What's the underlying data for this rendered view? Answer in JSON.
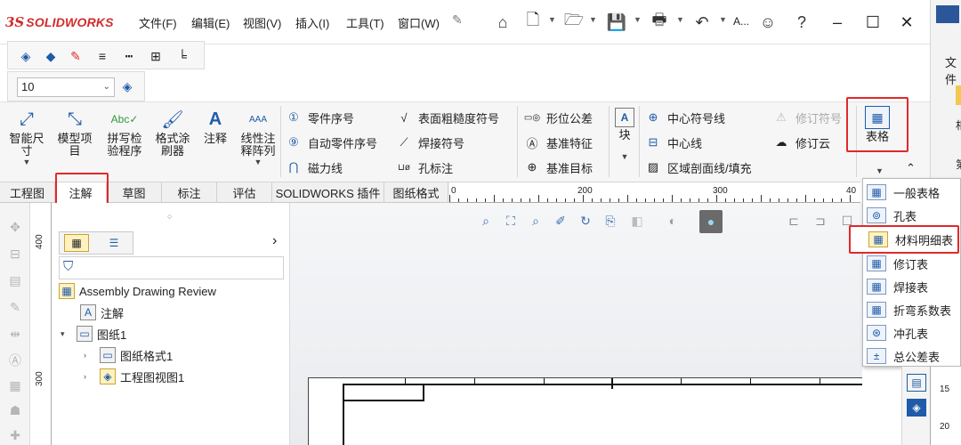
{
  "app": {
    "logo_mark": "3S",
    "logo_text": "SOLIDWORKS"
  },
  "menu": {
    "items": [
      "文件(F)",
      "编辑(E)",
      "视图(V)",
      "插入(I)",
      "工具(T)",
      "窗口(W)"
    ],
    "pin_icon": "pin-icon"
  },
  "quick_access": {
    "search_text": "A..."
  },
  "right_panel": {
    "label1": "文件",
    "label2": "相",
    "label3": "第"
  },
  "format": {
    "font_size": "10"
  },
  "ribbon": {
    "smart_dimension": "智能尺\n寸",
    "model_items": "模型项\n目",
    "spell_check": "拼写检\n验程序",
    "format_painter": "格式涂\n刷器",
    "note": "注释",
    "linear_pattern": "线性注\n释阵列",
    "balloon": "零件序号",
    "auto_balloon": "自动零件序号",
    "magnetic_line": "磁力线",
    "surface_finish": "表面粗糙度符号",
    "weld_symbol": "焊接符号",
    "hole_callout": "孔标注",
    "gtol": "形位公差",
    "datum_feature": "基准特征",
    "datum_target": "基准目标",
    "block": "块",
    "center_mark": "中心符号线",
    "centerline": "中心线",
    "area_hatch": "区域剖面线/填充",
    "revision_symbol": "修订符号",
    "revision_cloud": "修订云",
    "table": "表格"
  },
  "tabs": [
    "工程图",
    "注解",
    "草图",
    "标注",
    "评估",
    "SOLIDWORKS 插件",
    "图纸格式"
  ],
  "active_tab": "注解",
  "ruler": {
    "h_labels": [
      "0",
      "200",
      "300",
      "40"
    ],
    "v_labels": [
      "400",
      "300"
    ],
    "right_labels": [
      "15",
      "20"
    ]
  },
  "tree": {
    "items": [
      {
        "label": "Assembly Drawing Review",
        "icon": "drawing-icon"
      },
      {
        "label": "注解",
        "icon": "annotation-icon"
      },
      {
        "label": "图纸1",
        "icon": "sheet-icon"
      },
      {
        "label": "图纸格式1",
        "icon": "sheet-format-icon"
      },
      {
        "label": "工程图视图1",
        "icon": "drawing-view-icon"
      }
    ]
  },
  "table_menu": {
    "items": [
      {
        "label": "一般表格",
        "icon": "general-table-icon"
      },
      {
        "label": "孔表",
        "icon": "hole-table-icon"
      },
      {
        "label": "材料明细表",
        "icon": "bom-icon"
      },
      {
        "label": "修订表",
        "icon": "revision-table-icon"
      },
      {
        "label": "焊接表",
        "icon": "weld-table-icon"
      },
      {
        "label": "折弯系数表",
        "icon": "bend-table-icon"
      },
      {
        "label": "冲孔表",
        "icon": "punch-table-icon"
      },
      {
        "label": "总公差表",
        "icon": "tolerance-table-icon"
      }
    ]
  },
  "colors": {
    "highlight": "#e0292b",
    "brand": "#d22b2b",
    "icon_blue": "#1f5ba8"
  }
}
